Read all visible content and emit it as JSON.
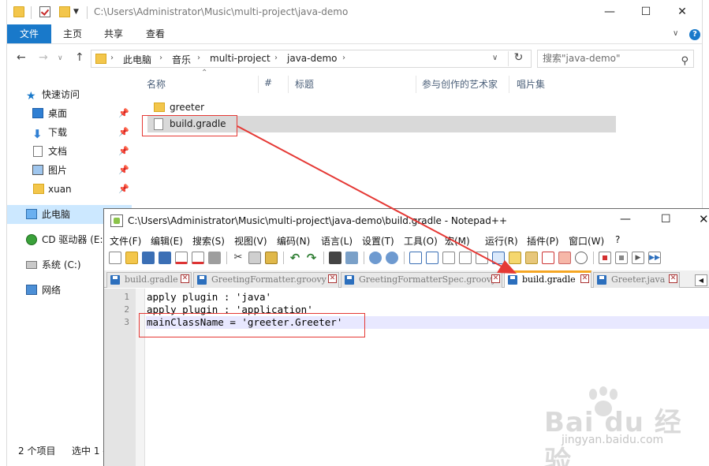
{
  "explorer": {
    "title": "C:\\Users\\Administrator\\Music\\multi-project\\java-demo",
    "window_controls": {
      "minimize": "—",
      "maximize": "☐",
      "close": "✕"
    },
    "ribbon": {
      "file": "文件",
      "home": "主页",
      "share": "共享",
      "view": "查看",
      "help": "?",
      "expand": "∨"
    },
    "nav": {
      "back": "←",
      "forward": "→",
      "recent": "∨",
      "up": "↑",
      "refresh": "↻"
    },
    "breadcrumbs": [
      "此电脑",
      "音乐",
      "multi-project",
      "java-demo"
    ],
    "search_placeholder": "搜索\"java-demo\"",
    "columns": [
      "名称",
      "#",
      "标题",
      "参与创作的艺术家",
      "唱片集"
    ],
    "sidebar": [
      {
        "label": "快速访问",
        "icon": "star-icon"
      },
      {
        "label": "桌面",
        "icon": "desktop-icon",
        "pinned": true
      },
      {
        "label": "下载",
        "icon": "download-icon",
        "pinned": true
      },
      {
        "label": "文档",
        "icon": "document-icon",
        "pinned": true
      },
      {
        "label": "图片",
        "icon": "pictures-icon",
        "pinned": true
      },
      {
        "label": "xuan",
        "icon": "folder-icon",
        "pinned": true
      },
      {
        "label": "此电脑",
        "icon": "computer-icon",
        "selected": true
      },
      {
        "label": "CD 驱动器 (E:)",
        "icon": "cd-drive-icon"
      },
      {
        "label": "系统 (C:)",
        "icon": "drive-icon"
      },
      {
        "label": "网络",
        "icon": "network-icon"
      }
    ],
    "files": [
      {
        "name": "greeter",
        "type": "folder"
      },
      {
        "name": "build.gradle",
        "type": "file",
        "selected": true
      }
    ],
    "status": {
      "count": "2 个项目",
      "selection": "选中 1 -"
    }
  },
  "notepad": {
    "title": "C:\\Users\\Administrator\\Music\\multi-project\\java-demo\\build.gradle - Notepad++",
    "window_controls": {
      "minimize": "—",
      "maximize": "☐",
      "close": "✕"
    },
    "menu": [
      "文件(F)",
      "编辑(E)",
      "搜索(S)",
      "视图(V)",
      "编码(N)",
      "语言(L)",
      "设置(T)",
      "工具(O)",
      "宏(M)",
      "运行(R)",
      "插件(P)",
      "窗口(W)",
      "?"
    ],
    "tabs": [
      {
        "label": "build.gradle",
        "active": false
      },
      {
        "label": "GreetingFormatter.groovy",
        "active": false
      },
      {
        "label": "GreetingFormatterSpec.groovy",
        "active": false
      },
      {
        "label": "build.gradle",
        "active": true
      },
      {
        "label": "Greeter.java",
        "active": false
      }
    ],
    "tab_close": "✕",
    "tab_scroll": "◀",
    "lines": [
      {
        "no": "1",
        "text": "apply plugin : 'java'"
      },
      {
        "no": "2",
        "text": "apply plugin : 'application'"
      },
      {
        "no": "3",
        "text": "mainClassName = 'greeter.Greeter'",
        "current": true
      }
    ]
  },
  "watermark": {
    "logo": "Bai du 经验",
    "url": "jingyan.baidu.com"
  },
  "colors": {
    "accent": "#1979ca",
    "annotation": "#e53935",
    "active_tab": "#f5a623"
  }
}
